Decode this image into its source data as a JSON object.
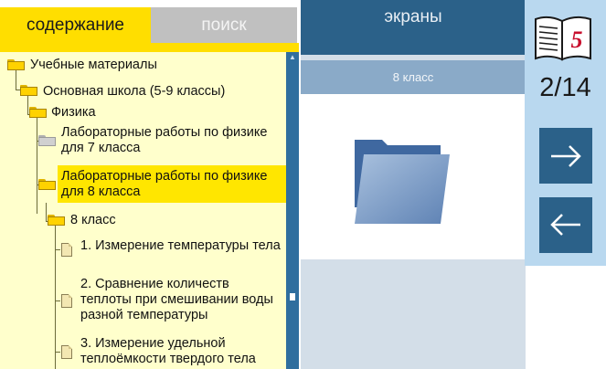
{
  "tabs": {
    "contents": "содержание",
    "search": "поиск"
  },
  "tree": [
    {
      "label": "Учебные материалы"
    },
    {
      "label": "Основная школа (5-9 классы)"
    },
    {
      "label": "Физика"
    },
    {
      "label": "Лабораторные работы по физике для 7 класса"
    },
    {
      "label": "Лабораторные работы по физике для 8 класса"
    },
    {
      "label": "8 класс"
    },
    {
      "label": "1. Измерение температуры тела"
    },
    {
      "label": "2. Сравнение количеств теплоты при смешивании воды разной температуры"
    },
    {
      "label": "3. Измерение удельной теплоёмкости твердого тела"
    }
  ],
  "middle": {
    "title": "экраны",
    "subtitle": "8 класс"
  },
  "right": {
    "page_indicator": "2/14",
    "book_badge": "5",
    "next_icon": "arrow-right-icon",
    "prev_icon": "arrow-left-icon"
  },
  "colors": {
    "accent_yellow": "#ffde00",
    "navy": "#2b6189",
    "tree_bg": "#ffffcc",
    "light_blue": "#b9d8ef"
  }
}
